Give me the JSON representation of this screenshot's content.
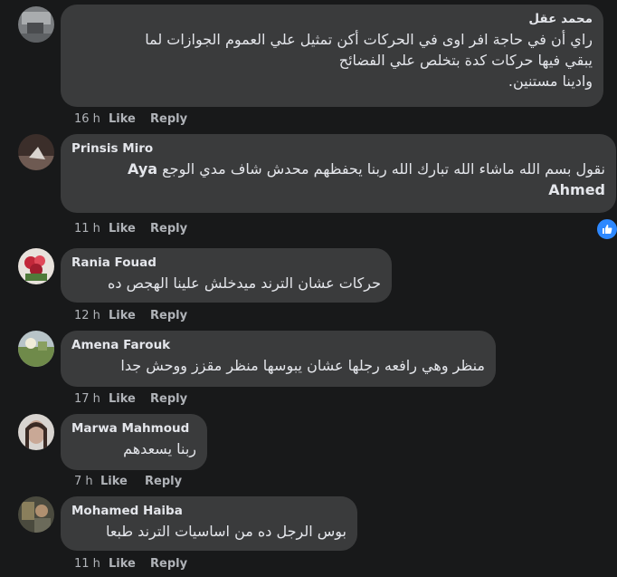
{
  "comments": [
    {
      "author": "محمد عقل",
      "text_lines": [
        "راي أن في حاجة افر اوى في الحركات أكن تمثيل علي العموم الجوازات لما",
        "يبقي فيها حركات كدة بتخلص علي الفضائح",
        "وادينا مستنين."
      ],
      "time": "16 h",
      "like": "Like",
      "reply": "Reply"
    },
    {
      "author": "Prinsis Miro",
      "text_lines": [
        "نقول بسم الله ماشاء الله تبارك الله ربنا يحفظهم محدش شاف مدي الوجع"
      ],
      "mention_first": "Aya",
      "mention_second": "Ahmed",
      "time": "11 h",
      "like": "Like",
      "reply": "Reply"
    },
    {
      "author": "Rania Fouad",
      "text_lines": [
        "حركات عشان الترند ميدخلش علينا الهجص ده"
      ],
      "time": "12 h",
      "like": "Like",
      "reply": "Reply"
    },
    {
      "author": "Amena Farouk",
      "text_lines": [
        "منظر وهي رافعه رجلها عشان يبوسها منظر مقزز ووحش جدا"
      ],
      "time": "17 h",
      "like": "Like",
      "reply": "Reply"
    },
    {
      "author": "Marwa Mahmoud",
      "text_lines": [
        "ربنا يسعدهم"
      ],
      "time": "7 h",
      "like": "Like",
      "reply": "Reply"
    },
    {
      "author": "Mohamed Haiba",
      "text_lines": [
        "بوس الرجل ده من اساسيات الترند طبعا"
      ],
      "time": "11 h",
      "like": "Like",
      "reply": "Reply"
    }
  ],
  "colors": {
    "background": "#18191a",
    "bubble": "#3a3b3c",
    "text": "#e4e6eb",
    "secondary": "#b0b3b8",
    "like_badge": "#2d88ff"
  },
  "icons": {
    "reaction_badge": "thumbs-up-icon"
  }
}
